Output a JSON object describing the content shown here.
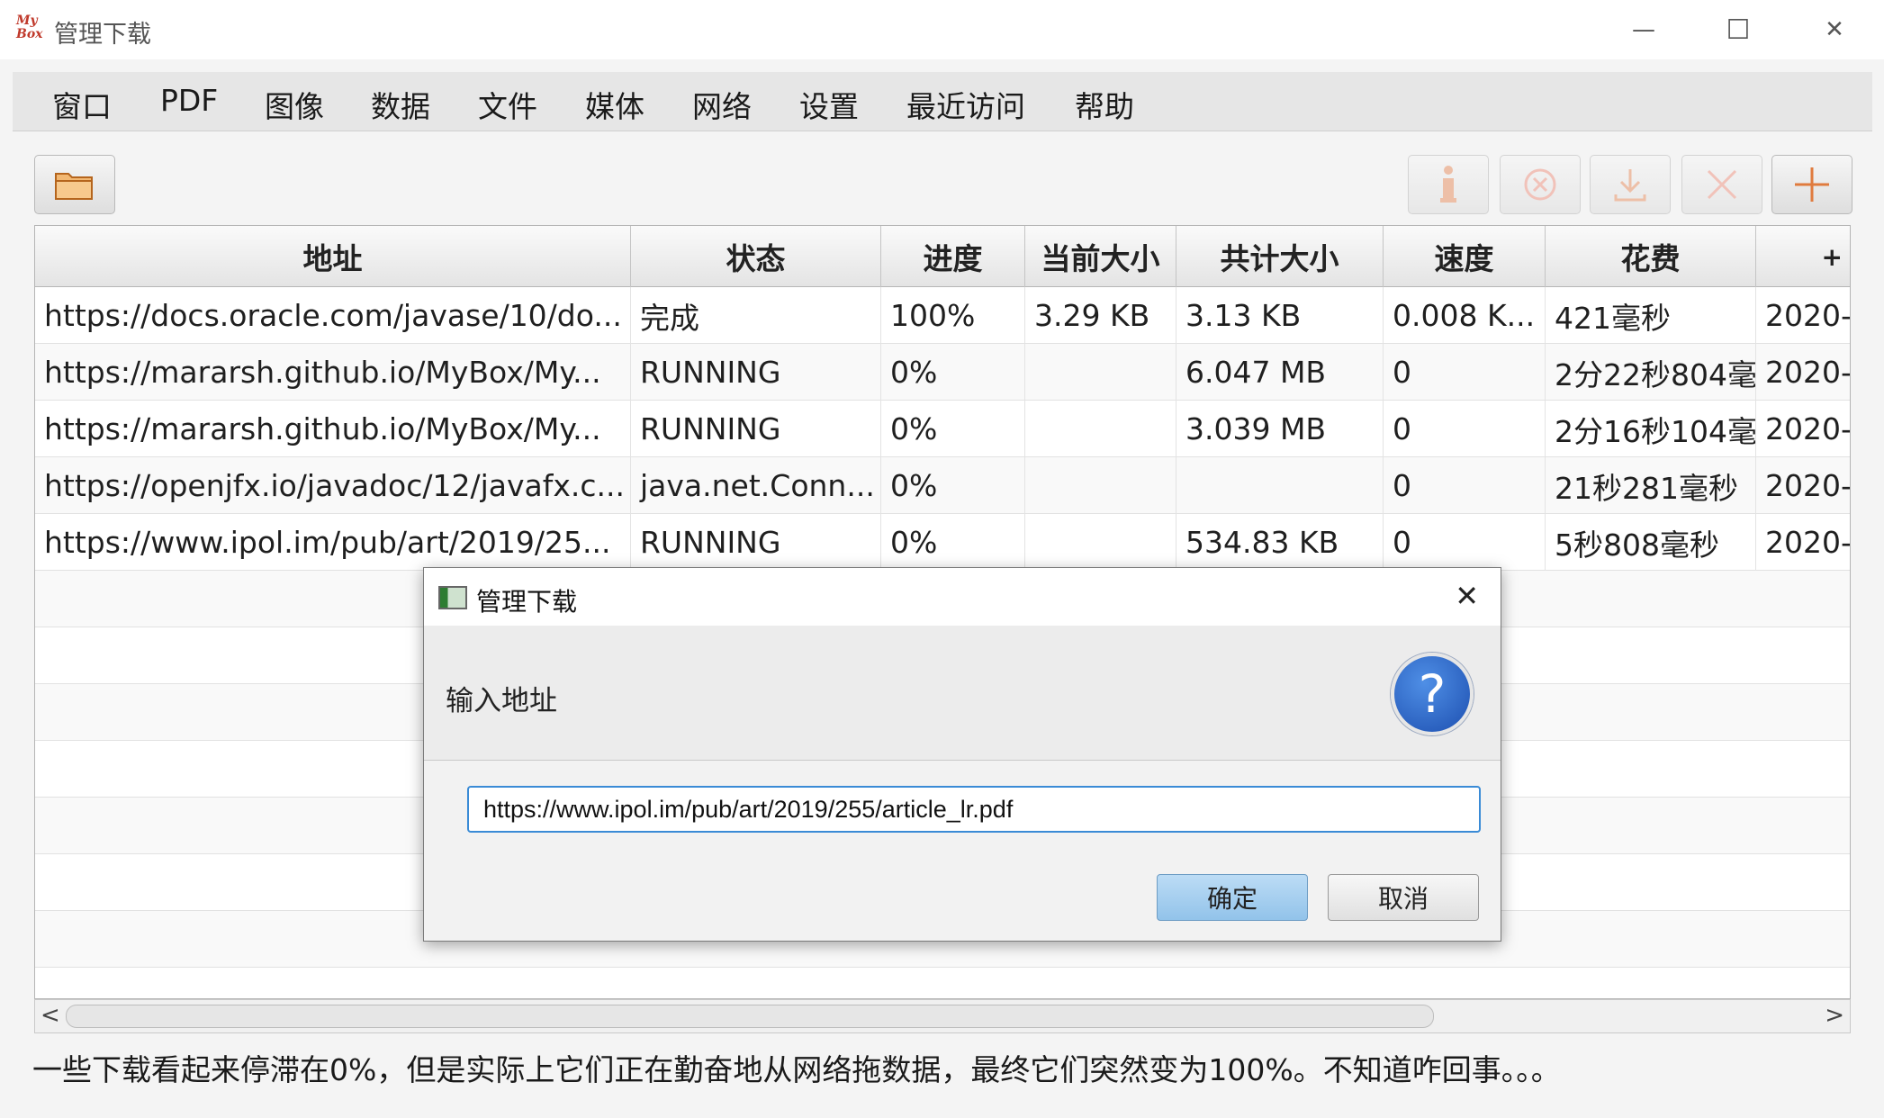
{
  "window": {
    "logo_line1": "My",
    "logo_line2": "Box",
    "title": "管理下载",
    "minimize": "—",
    "maximize": "☐",
    "close": "✕"
  },
  "menu": [
    "窗口",
    "PDF",
    "图像",
    "数据",
    "文件",
    "媒体",
    "网络",
    "设置",
    "最近访问",
    "帮助"
  ],
  "toolbar": {
    "open_folder": "folder-icon",
    "info": "info-icon",
    "stop": "stop-icon",
    "download": "download-icon",
    "delete": "delete-icon",
    "add": "add-icon"
  },
  "table": {
    "columns": [
      "地址",
      "状态",
      "进度",
      "当前大小",
      "共计大小",
      "速度",
      "花费",
      "+"
    ],
    "rows": [
      [
        "https://docs.oracle.com/javase/10/do...",
        "完成",
        "100%",
        "3.29 KB",
        "3.13 KB",
        "0.008 K...",
        "421毫秒",
        "2020-"
      ],
      [
        "https://mararsh.github.io/MyBox/My...",
        "RUNNING",
        "0%",
        "",
        "6.047 MB",
        "0",
        "2分22秒804毫",
        "2020-("
      ],
      [
        "https://mararsh.github.io/MyBox/My...",
        "RUNNING",
        "0%",
        "",
        "3.039 MB",
        "0",
        "2分16秒104毫",
        "2020-("
      ],
      [
        "https://openjfx.io/javadoc/12/javafx.c...",
        "java.net.Conn...",
        "0%",
        "",
        "",
        "0",
        "21秒281毫秒",
        "2020-("
      ],
      [
        "https://www.ipol.im/pub/art/2019/25...",
        "RUNNING",
        "0%",
        "",
        "534.83 KB",
        "0",
        "5秒808毫秒",
        "2020-("
      ]
    ]
  },
  "scrollbar": {
    "left_arrow": "<",
    "right_arrow": ">"
  },
  "status_note": "一些下载看起来停滞在0%，但是实际上它们正在勤奋地从网络拖数据，最终它们突然变为100%。不知道咋回事。。。",
  "dialog": {
    "title": "管理下载",
    "close": "✕",
    "header": "输入地址",
    "question_icon": "?",
    "input_value": "https://www.ipol.im/pub/art/2019/255/article_lr.pdf",
    "ok": "确定",
    "cancel": "取消"
  }
}
